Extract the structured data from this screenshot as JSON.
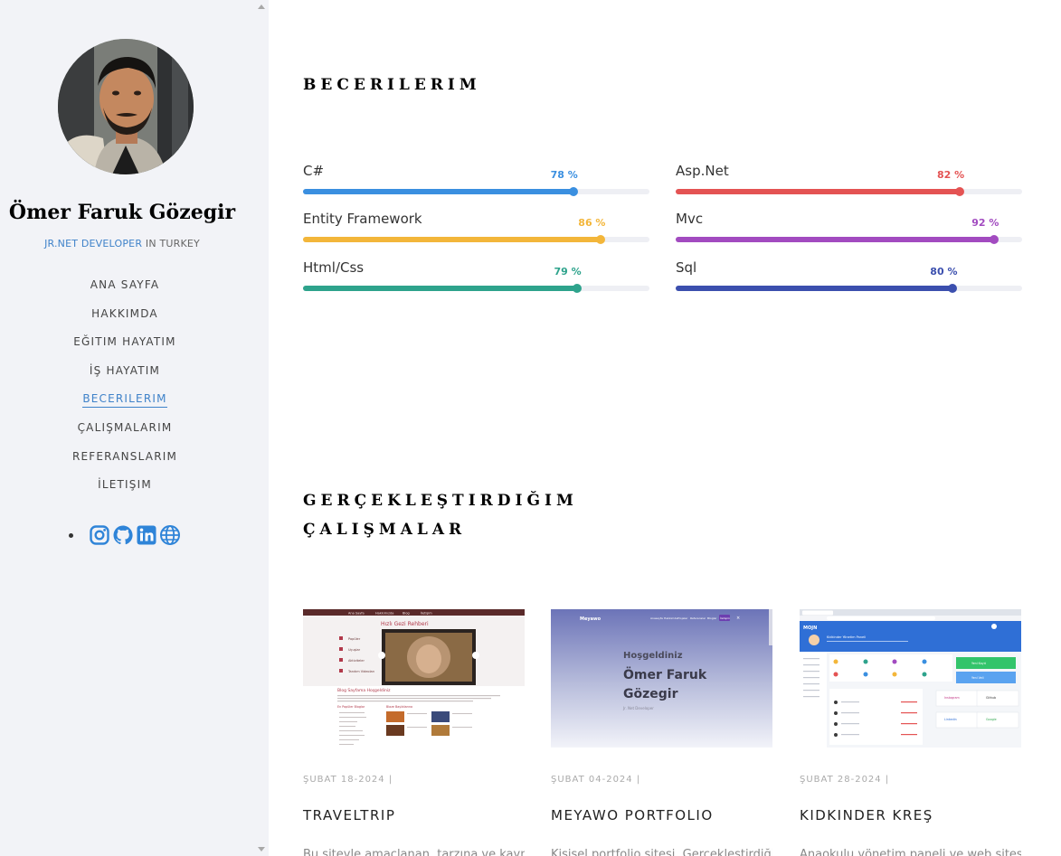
{
  "profile": {
    "name": "Ömer Faruk Gözegir",
    "role_highlight": "JR.NET DEVELOPER",
    "role_rest": " IN TURKEY"
  },
  "nav": {
    "items": [
      {
        "label": "ANA SAYFA",
        "active": false
      },
      {
        "label": "HAKKIMDA",
        "active": false
      },
      {
        "label": "EĞITIM HAYATIM",
        "active": false
      },
      {
        "label": "İŞ HAYATIM",
        "active": false
      },
      {
        "label": "BECERILERIM",
        "active": true
      },
      {
        "label": "ÇALIŞMALARIM",
        "active": false
      },
      {
        "label": "REFERANSLARIM",
        "active": false
      },
      {
        "label": "İLETIŞIM",
        "active": false
      }
    ]
  },
  "social": {
    "icons": [
      "instagram-icon",
      "github-icon",
      "linkedin-icon",
      "globe-icon"
    ],
    "color": "#2f84d8"
  },
  "skills_section": {
    "title": "BECERILERIM",
    "skills": [
      {
        "name": "C#",
        "percent": 78,
        "label": "78 %",
        "color": "#3a8fe0"
      },
      {
        "name": "Asp.Net",
        "percent": 82,
        "label": "82 %",
        "color": "#e45353"
      },
      {
        "name": "Entity Framework",
        "percent": 86,
        "label": "86 %",
        "color": "#f3b63a"
      },
      {
        "name": "Mvc",
        "percent": 92,
        "label": "92 %",
        "color": "#a24bc0"
      },
      {
        "name": "Html/Css",
        "percent": 79,
        "label": "79 %",
        "color": "#2ea38c"
      },
      {
        "name": "Sql",
        "percent": 80,
        "label": "80 %",
        "color": "#3b4fae"
      }
    ]
  },
  "works_section": {
    "title_line1": "GERÇEKLEŞTIRDIĞIM",
    "title_line2": "ÇALIŞMALAR",
    "cards": [
      {
        "date": "ŞUBAT 18-2024 |",
        "title": "TRAVELTRIP",
        "excerpt": "Bu siteyle amaçlanan, tarzına ve kaynakları",
        "thumb": {
          "nav_items": [
            "Ana Sayfa",
            "Hakkımızda",
            "Blog",
            "İletişim"
          ],
          "heading": "Hızlı Gezi Rehberi",
          "menu": [
            "Popüler",
            "Uçuşlar",
            "Aktiviteler",
            "Tanıtım Videoları"
          ],
          "blog_title": "Blog Sayfama Hoşgeldiniz",
          "col1_title": "En Popüler Bloglar",
          "col2_title": "Blaze Başlıklarına"
        }
      },
      {
        "date": "ŞUBAT 04-2024 |",
        "title": "MEYAWO PORTFOLIO",
        "excerpt": "Kişisel portfolio sitesi, Gerçekleştirdiğim",
        "thumb": {
          "brand": "Meyawo",
          "nav_items": [
            "Anasayfa",
            "Hakkımda",
            "Projeler",
            "Referanslar",
            "Bloglar",
            "İletişim"
          ],
          "greeting": "Hoşgeldiniz",
          "name_line1": "Ömer Faruk",
          "name_line2": "Gözegir",
          "subtitle": "Jr. Net Developer"
        }
      },
      {
        "date": "ŞUBAT 28-2024 |",
        "title": "KIDKINDER KREŞ",
        "excerpt": "Anaokulu yönetim paneli ve web sitesi",
        "thumb": {
          "brand": "MOJN",
          "banner_title": "Kidkinder Yönetim Paneli",
          "tiles": [
            "Yeni Kayıt",
            "Yeni Veli",
            "Instagram",
            "Github",
            "Linkedin",
            "Google"
          ]
        }
      }
    ]
  }
}
